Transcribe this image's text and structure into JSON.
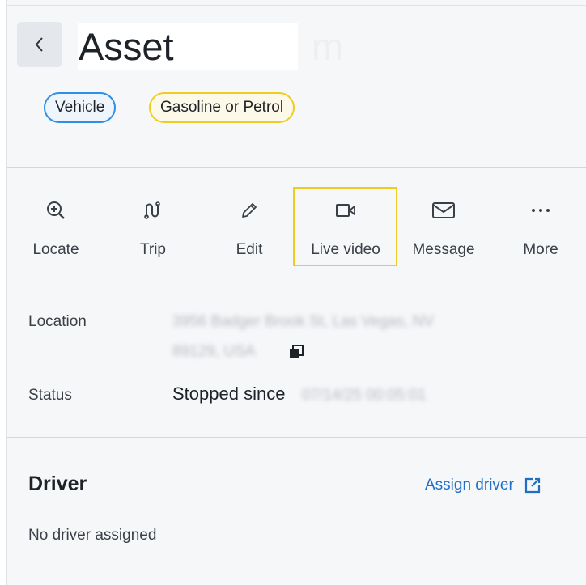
{
  "header": {
    "back_label": "<",
    "title": "Asset",
    "title_obscured_tail": "m"
  },
  "tags": [
    {
      "label": "Vehicle",
      "color": "#2f8ee5"
    },
    {
      "label": "Gasoline or Petrol",
      "color": "#f0cc22"
    }
  ],
  "actions": [
    {
      "label": "Locate",
      "icon": "zoom-in-icon"
    },
    {
      "label": "Trip",
      "icon": "route-icon"
    },
    {
      "label": "Edit",
      "icon": "pencil-icon"
    },
    {
      "label": "Live video",
      "icon": "video-camera-icon",
      "highlighted": true
    },
    {
      "label": "Message",
      "icon": "envelope-icon"
    },
    {
      "label": "More",
      "icon": "more-dots-icon"
    }
  ],
  "details": {
    "location_label": "Location",
    "location_value_line1": "3956 Badger Brook St, Las Vegas, NV",
    "location_value_line2": "89129, USA",
    "status_label": "Status",
    "status_prefix": "Stopped since",
    "status_timestamp": "07/14/25 00:05:01"
  },
  "driver": {
    "title": "Driver",
    "assign_label": "Assign driver",
    "empty_text": "No driver assigned"
  },
  "colors": {
    "highlight": "#f0cc22",
    "link": "#1f6fc4",
    "vehicle_chip": "#2f8ee5"
  }
}
